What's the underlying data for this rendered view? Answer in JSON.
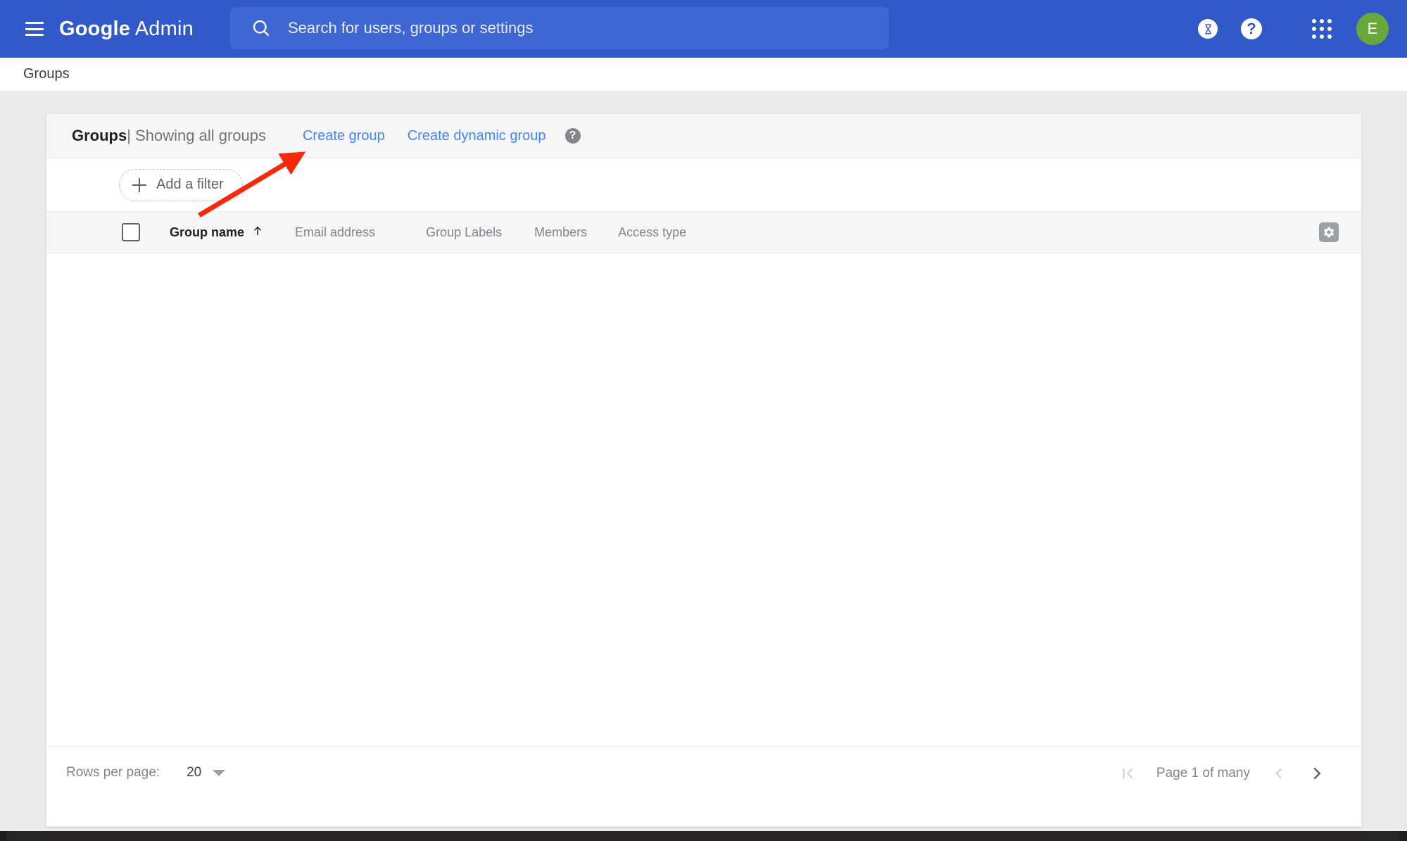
{
  "appbar": {
    "menu_icon": "hamburger-icon",
    "brand_bold": "Google",
    "brand_light": "Admin",
    "search": {
      "icon": "search-icon",
      "placeholder": "Search for users, groups or settings",
      "value": ""
    },
    "trial_icon": "hourglass-icon",
    "help_icon": "help-icon",
    "help_glyph": "?",
    "apps_icon": "apps-grid-icon",
    "avatar": {
      "initial": "E",
      "color": "#69a63b"
    }
  },
  "breadcrumb": {
    "current": "Groups"
  },
  "card": {
    "title": "Groups",
    "separator": "|",
    "subtitle": "Showing all groups",
    "create_group_label": "Create group",
    "create_dynamic_group_label": "Create dynamic group",
    "help_glyph": "?",
    "filter": {
      "label": "Add a filter",
      "icon": "plus-icon"
    },
    "table": {
      "select_all_checked": false,
      "columns": [
        {
          "label": "Group name",
          "sorted": true,
          "sort_icon": "arrow-up-icon"
        },
        {
          "label": "Email address",
          "sorted": false
        },
        {
          "label": "Group Labels",
          "sorted": false
        },
        {
          "label": "Members",
          "sorted": false
        },
        {
          "label": "Access type",
          "sorted": false
        }
      ],
      "settings_icon": "gear-icon",
      "rows": []
    },
    "footer": {
      "rows_per_page_label": "Rows per page:",
      "rows_per_page_value": "20",
      "dropdown_icon": "chevron-down-icon",
      "first_page_icon": "first-page-icon",
      "page_label": "Page 1 of many",
      "prev_page_icon": "chevron-left-icon",
      "next_page_icon": "chevron-right-icon"
    }
  },
  "annotation": {
    "type": "arrow",
    "color": "#f4290d",
    "points_to": "Create group"
  },
  "colors": {
    "appbar_blue": "#3159c9",
    "search_field_blue": "#3f67d3",
    "link_blue": "#4285f4",
    "page_background": "#ebebeb",
    "card_header_gray": "#f6f6f6"
  }
}
